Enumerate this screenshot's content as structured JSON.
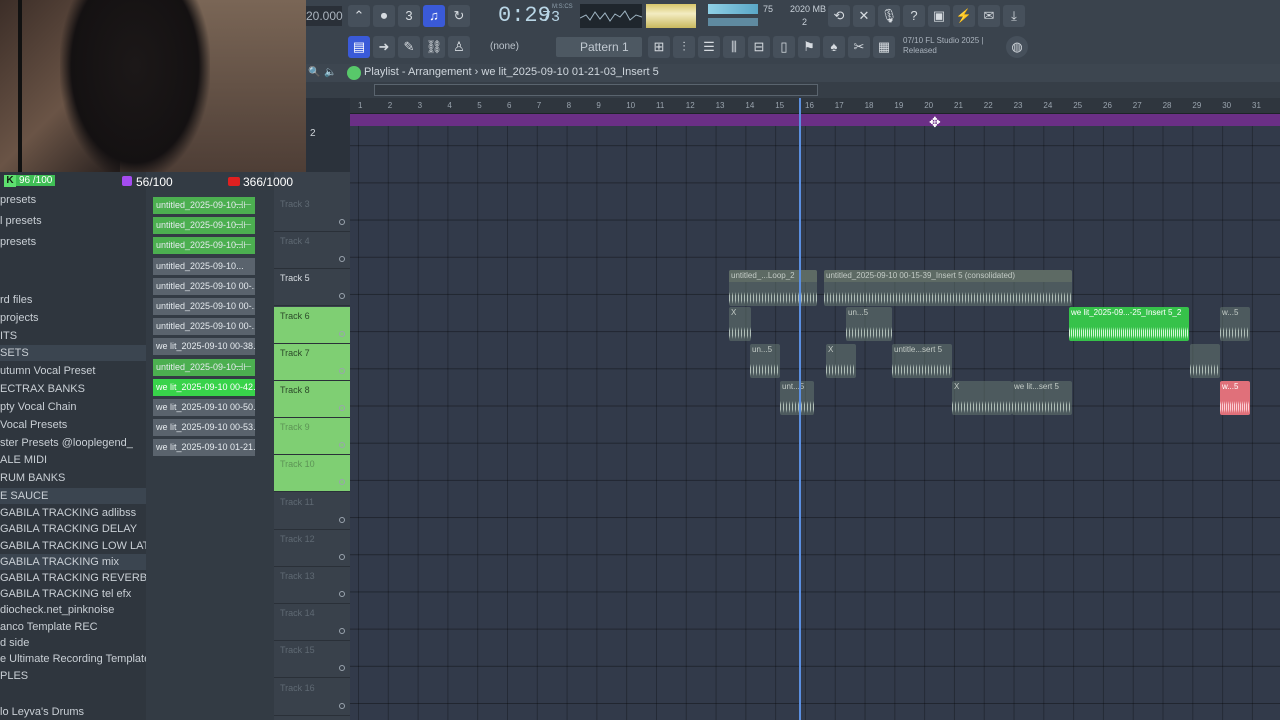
{
  "toolbar": {
    "tempo": "20.000",
    "time_main": "0:29",
    "time_frac": "73",
    "time_unit": "M:S:CS",
    "cpu": "75",
    "memory": "2020 MB",
    "voices": "2",
    "none_select": "(none)",
    "pattern": "Pattern 1",
    "news_line1": "07/10  FL Studio 2025 |",
    "news_line2": "Released"
  },
  "playlist": {
    "title": "Playlist - Arrangement",
    "arrangement": "we lit_2025-09-10 01-21-03_Insert 5",
    "lane_label": "2"
  },
  "ruler": [
    "1",
    "2",
    "3",
    "4",
    "5",
    "6",
    "7",
    "8",
    "9",
    "10",
    "11",
    "12",
    "13",
    "14",
    "15",
    "16",
    "17",
    "18",
    "19",
    "20",
    "21",
    "22",
    "23",
    "24",
    "25",
    "26",
    "27",
    "28",
    "29",
    "30",
    "31"
  ],
  "tracks": [
    {
      "name": "Track 3"
    },
    {
      "name": "Track 4"
    },
    {
      "name": "Track 5"
    },
    {
      "name": "Track 6"
    },
    {
      "name": "Track 7"
    },
    {
      "name": "Track 8"
    },
    {
      "name": "Track 9"
    },
    {
      "name": "Track 10"
    },
    {
      "name": "Track 11"
    },
    {
      "name": "Track 12"
    },
    {
      "name": "Track 13"
    },
    {
      "name": "Track 14"
    },
    {
      "name": "Track 15"
    },
    {
      "name": "Track 16"
    }
  ],
  "badges": {
    "kick": "96 /100",
    "twitch": "56/100",
    "youtube": "366/1000"
  },
  "browser": [
    "presets",
    "l presets",
    "presets",
    "rd files",
    "projects",
    "ITS",
    "SETS",
    "utumn Vocal Preset",
    "ECTRAX BANKS",
    "pty Vocal Chain",
    "Vocal Presets",
    "ster Presets @looplegend_",
    "RUM BANKS",
    "ALE MIDI",
    "E SAUCE",
    "GABILA TRACKING adlibss",
    "GABILA TRACKING DELAY",
    "GABILA TRACKING LOW LATENCY",
    "GABILA TRACKING mix",
    "GABILA TRACKING REVERB",
    "GABILA TRACKING tel efx",
    "diocheck.net_pinknoise",
    "anco Template REC",
    "d side",
    "e Ultimate Recording Template",
    "PLES",
    "lo Leyva's Drums"
  ],
  "picker": [
    {
      "label": "untitled_2025-09-10..."
    },
    {
      "label": "untitled_2025-09-10..."
    },
    {
      "label": "untitled_2025-09-10..."
    },
    {
      "label": "untitled_2025-09-10..."
    },
    {
      "label": "untitled_2025-09-10 00-..."
    },
    {
      "label": "untitled_2025-09-10 00-..."
    },
    {
      "label": "untitled_2025-09-10 00-..."
    },
    {
      "label": "we lit_2025-09-10 00-38..."
    },
    {
      "label": "untitled_2025-09-10..."
    },
    {
      "label": "we lit_2025-09-10 00-42..."
    },
    {
      "label": "we lit_2025-09-10 00-50..."
    },
    {
      "label": "we lit_2025-09-10 00-53..."
    },
    {
      "label": "we lit_2025-09-10 01-21..."
    }
  ],
  "clips": {
    "loop2": "untitled_...Loop_2",
    "consolidated": "untitled_2025-09-10 00-15-39_Insert 5 (consolidated)",
    "welit25": "we lit_2025-09...-25_Insert 5_2",
    "w5a": "w...5",
    "un5a": "un...5",
    "x1": "X",
    "untitled_sert": "untitle...sert 5",
    "un5b": "un...5",
    "unt5": "unt...5",
    "welit_sert": "we lit...sert 5",
    "w5red": "w...5",
    "x2": "X",
    "x3": "X"
  }
}
